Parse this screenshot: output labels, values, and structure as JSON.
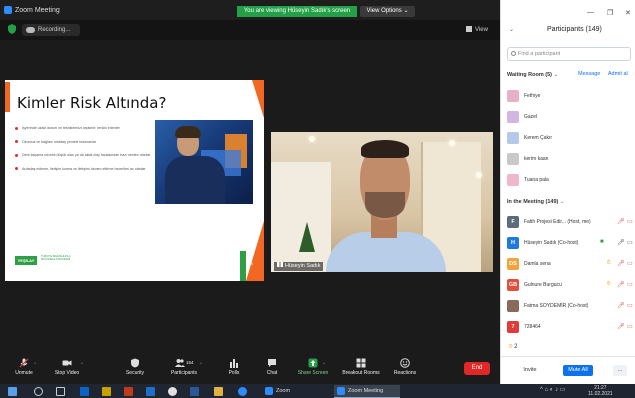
{
  "window": {
    "title": "Zoom Meeting",
    "viewing_banner": "You are viewing Hüseyin Sadık's screen",
    "view_options": "View Options ⌄"
  },
  "recording": {
    "label": "Recording..."
  },
  "view_button": "View",
  "slide": {
    "title": "Kimler Risk Altında?",
    "bullets": [
      "İşyerinde uzakl durum ve teknikerinizi arşisme: terslık edenler",
      "Okumuz ve bağlanı ortadaş yemesi bulunanlar",
      "Ders kaçama sıkıntılı düşük olan ya da aktal olay fazlasından bazı sentez olanlar",
      "Ardadaş edinme, iletişim kurma ve iletişimi devam ettirme becerileri az olanlar"
    ],
    "logo": "YEŞİLAY",
    "logo_sub": "TÜRKİYE BAĞIMLILIKLA MÜCADELE PROGRAMI",
    "page_num": "258"
  },
  "presenter": {
    "name": "Hüseyin Sadık"
  },
  "toolbar": {
    "unmute": "Unmute",
    "stop_video": "Stop Video",
    "security": "Security",
    "participants": "Participants",
    "participant_count": "154",
    "polls": "Polls",
    "chat": "Chat",
    "share_screen": "Share Screen",
    "breakout_rooms": "Breakout Rooms",
    "reactions": "Reactions",
    "end": "End"
  },
  "panel": {
    "title": "Participants (149)",
    "search_placeholder": "Find a participant",
    "waiting_room": "Waiting Room (5)",
    "message": "Message",
    "admit_all": "Admit al",
    "waiting": [
      {
        "name": "Fethiye",
        "color": "#e8b0c8"
      },
      {
        "name": "Gazel",
        "color": "#d0b6e0"
      },
      {
        "name": "Kerem Çakır",
        "color": "#b6c8ea"
      },
      {
        "name": "kerim kaan",
        "color": "#c8c8c8"
      },
      {
        "name": "Tuana pala",
        "color": "#f0b7c8"
      }
    ],
    "in_meeting": "In the Meeting (149)",
    "members": [
      {
        "initials": "F",
        "name": "Fatih Projesi Edir... (Host, me)",
        "color": "#5c6b7a"
      },
      {
        "initials": "H",
        "name": "Hüseyin Sadık (Co-host)",
        "color": "#1f7ae0"
      },
      {
        "initials": "DS",
        "name": "Damla sena",
        "color": "#f2a33a"
      },
      {
        "initials": "GB",
        "name": "Gulnure Burgucu",
        "color": "#e0503f"
      },
      {
        "initials": "",
        "name": "Fatma SOYDEMİR (Co-host)",
        "color": "#8a6a5a"
      },
      {
        "initials": "7",
        "name": "728464",
        "color": "#e03b3b"
      }
    ],
    "hands_raised": "2",
    "invite": "Invite",
    "mute_all": "Mute All",
    "more": "..."
  },
  "taskbar": {
    "zoom_1": "Zoom",
    "zoom_2": "Zoom Meeting",
    "time": "21:27",
    "date": "11.02.2021"
  }
}
